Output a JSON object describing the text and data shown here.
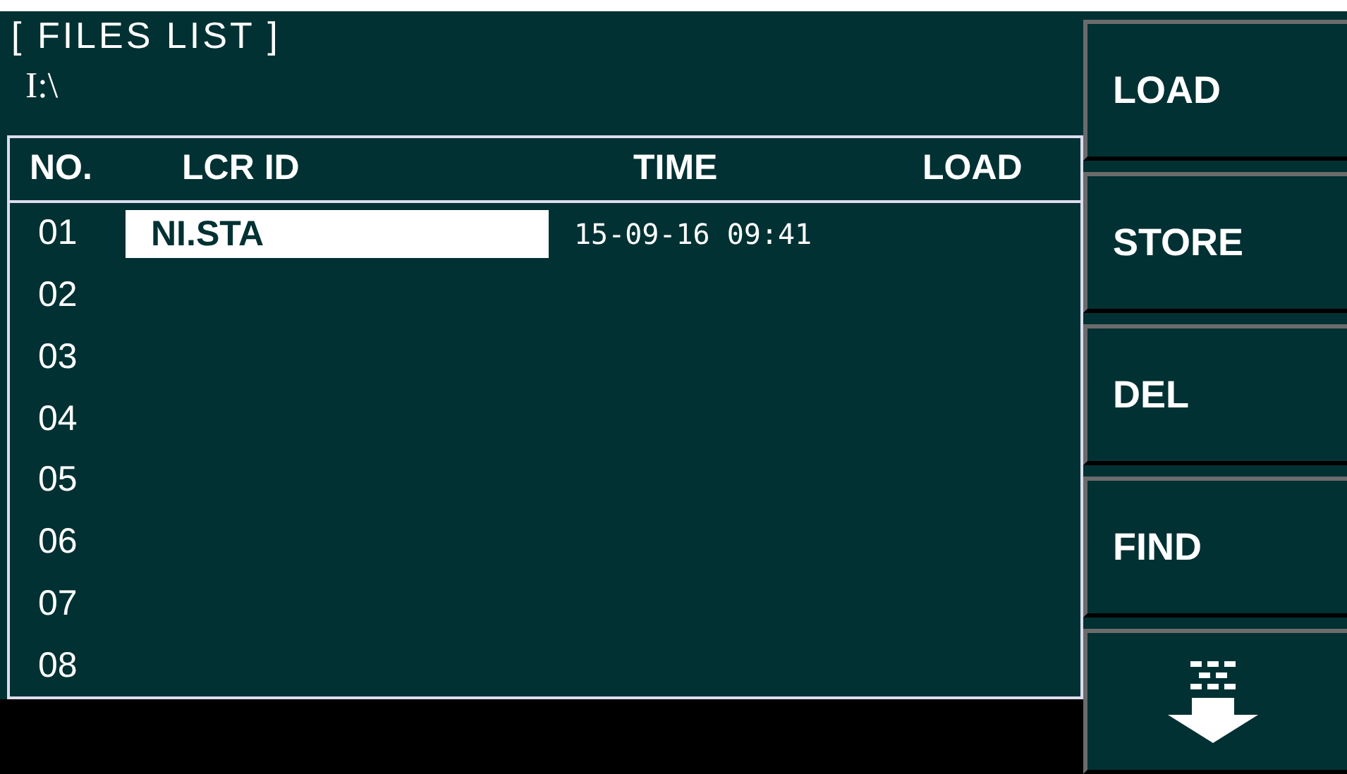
{
  "title": "[ FILES LIST ]",
  "path": "I:\\",
  "columns": [
    "NO.",
    "LCR ID",
    "TIME",
    "LOAD"
  ],
  "rows": [
    {
      "no": "01",
      "lcr_id": "NI.STA",
      "time": "15-09-16 09:41",
      "selected": true
    },
    {
      "no": "02",
      "selected": false
    },
    {
      "no": "03",
      "selected": false
    },
    {
      "no": "04",
      "selected": false
    },
    {
      "no": "05",
      "selected": false
    },
    {
      "no": "06",
      "selected": false
    },
    {
      "no": "07",
      "selected": false
    },
    {
      "no": "08",
      "selected": false
    }
  ],
  "softkeys": [
    {
      "kind": "text",
      "label": "LOAD"
    },
    {
      "kind": "text",
      "label": "STORE"
    },
    {
      "kind": "text",
      "label": "DEL"
    },
    {
      "kind": "text",
      "label": "FIND"
    },
    {
      "kind": "page-down"
    }
  ]
}
